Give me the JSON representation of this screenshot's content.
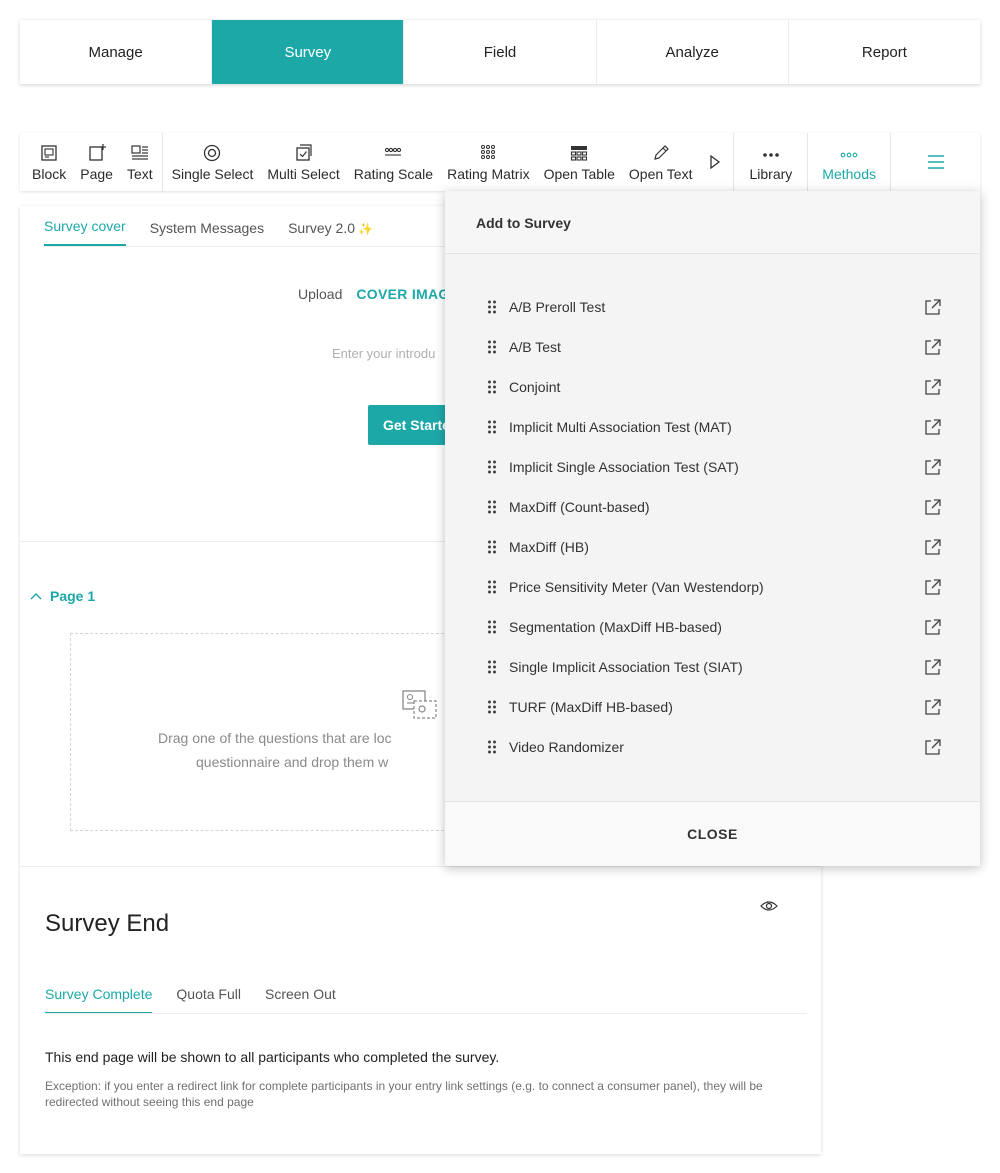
{
  "nav": {
    "tabs": [
      {
        "label": "Manage"
      },
      {
        "label": "Survey"
      },
      {
        "label": "Field"
      },
      {
        "label": "Analyze"
      },
      {
        "label": "Report"
      }
    ],
    "active": "Survey"
  },
  "toolbar": {
    "block": "Block",
    "page": "Page",
    "text": "Text",
    "single_select": "Single Select",
    "multi_select": "Multi Select",
    "rating_scale": "Rating Scale",
    "rating_matrix": "Rating Matrix",
    "open_table": "Open Table",
    "open_text": "Open Text",
    "library": "Library",
    "methods": "Methods"
  },
  "cover": {
    "tabs": [
      "Survey cover",
      "System Messages",
      "Survey 2.0"
    ],
    "sparkle": "✨",
    "upload": "Upload",
    "cover_image": "COVER IMAGE",
    "intro_placeholder": "Enter your introdu",
    "get_started": "Get Starte"
  },
  "page": {
    "title": "Page 1",
    "drop_line1": "Drag one of the questions that are loc",
    "drop_line2": "questionnaire and drop them w"
  },
  "survey_end": {
    "title": "Survey End",
    "tabs": [
      "Survey Complete",
      "Quota Full",
      "Screen Out"
    ],
    "message": "This end page will be shown to all participants who completed the survey.",
    "note": "Exception: if you enter a redirect link for complete participants in your entry link settings (e.g. to connect a consumer panel), they will be redirected without seeing this end page"
  },
  "methods_panel": {
    "title": "Add to Survey",
    "items": [
      "A/B Preroll Test",
      "A/B Test",
      "Conjoint",
      "Implicit Multi Association Test (MAT)",
      "Implicit Single Association Test (SAT)",
      "MaxDiff (Count-based)",
      "MaxDiff (HB)",
      "Price Sensitivity Meter (Van Westendorp)",
      "Segmentation (MaxDiff HB-based)",
      "Single Implicit Association Test (SIAT)",
      "TURF (MaxDiff HB-based)",
      "Video Randomizer"
    ],
    "close": "CLOSE"
  },
  "colors": {
    "accent": "#1da8a8"
  }
}
